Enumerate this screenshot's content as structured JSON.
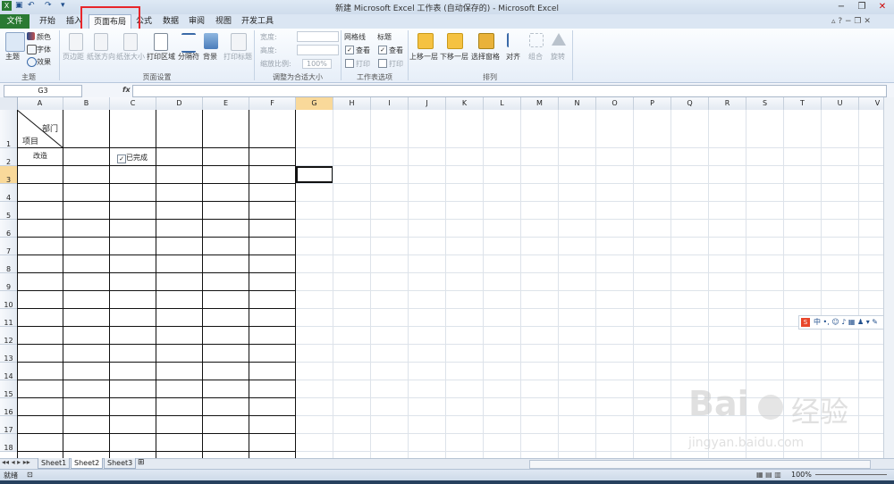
{
  "window": {
    "title": "新建 Microsoft Excel 工作表 (自动保存的) - Microsoft Excel",
    "controls": [
      "−",
      "❐",
      "✕"
    ]
  },
  "tabs": [
    "文件",
    "开始",
    "插入",
    "页面布局",
    "公式",
    "数据",
    "审阅",
    "视图",
    "开发工具"
  ],
  "ribbon": {
    "themes": {
      "main": "主题",
      "colors": "颜色",
      "fonts": "字体",
      "effects": "效果",
      "group": "主题"
    },
    "page_setup": {
      "items": [
        "页边距",
        "纸张方向",
        "纸张大小",
        "打印区域",
        "分隔符",
        "背景",
        "打印标题"
      ],
      "group": "页面设置"
    },
    "scale": {
      "width": "宽度:",
      "height": "高度:",
      "scale": "缩放比例:",
      "scale_value": "100%",
      "group": "调整为合适大小"
    },
    "sheet_options": {
      "gridlines": "网格线",
      "headings": "标题",
      "view": "查看",
      "print": "打印",
      "group": "工作表选项"
    },
    "arrange": {
      "items": [
        "上移一层",
        "下移一层",
        "选择窗格",
        "对齐",
        "组合",
        "旋转"
      ],
      "group": "排列"
    }
  },
  "formula_bar": {
    "name_box": "G3",
    "fx": "fx"
  },
  "columns": [
    "A",
    "B",
    "C",
    "D",
    "E",
    "F",
    "G",
    "H",
    "I",
    "J",
    "K",
    "L",
    "M",
    "N",
    "O",
    "P",
    "Q",
    "R",
    "S",
    "T",
    "U",
    "V"
  ],
  "rows": [
    "1",
    "2",
    "3",
    "4",
    "5",
    "6",
    "7",
    "8",
    "9",
    "10",
    "11",
    "12",
    "13",
    "14",
    "15",
    "16",
    "17",
    "18"
  ],
  "cells": {
    "a1_top": "部门",
    "a1_bottom": "项目",
    "a2": "改造",
    "c2": "已完成"
  },
  "sheets": [
    "Sheet1",
    "Sheet2",
    "Sheet3"
  ],
  "status": {
    "ready": "就绪",
    "zoom": "100%"
  },
  "watermark": {
    "brand": "Bai",
    "cn": "经验",
    "url": "jingyan.baidu.com"
  },
  "colors": {
    "file_tab": "#2a7a32",
    "highlight": "#e8262b",
    "selection": "#111111"
  }
}
